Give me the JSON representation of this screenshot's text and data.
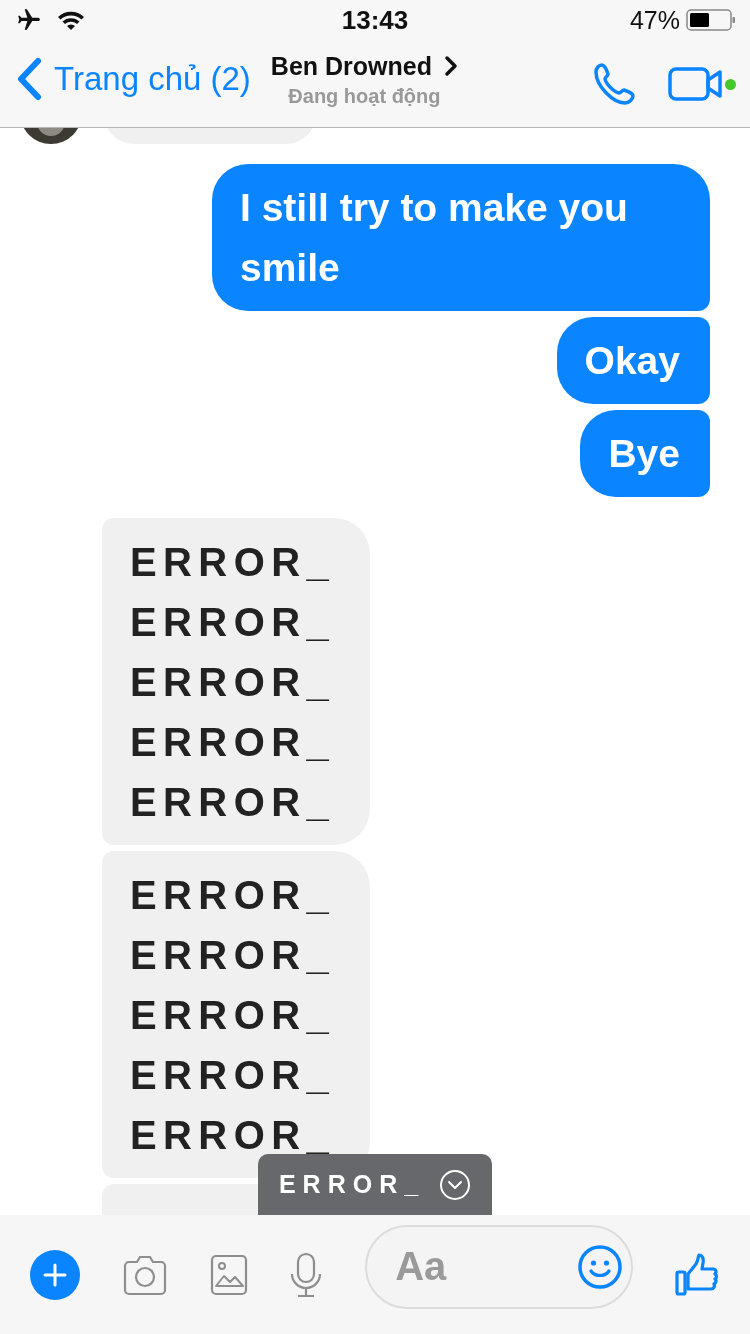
{
  "status_bar": {
    "time": "13:43",
    "battery": "47%"
  },
  "header": {
    "back": "Trang chủ (2)",
    "contact": "Ben Drowned",
    "status": "Đang hoạt động",
    "online": true
  },
  "messages": [
    {
      "kind": "clipped"
    },
    {
      "kind": "outgoing",
      "text": "I still try to make you smile"
    },
    {
      "kind": "outgoing",
      "text": "Okay"
    },
    {
      "kind": "outgoing",
      "text": "Bye"
    },
    {
      "kind": "incoming",
      "lines": [
        "ERROR_",
        "ERROR_",
        "ERROR_",
        "ERROR_",
        "ERROR_"
      ]
    },
    {
      "kind": "incoming",
      "lines": [
        "ERROR_",
        "ERROR_",
        "ERROR_",
        "ERROR_",
        "ERROR_"
      ]
    },
    {
      "kind": "clipped-bottom"
    }
  ],
  "new_message_pill": {
    "label": "ERROR_"
  },
  "composer": {
    "placeholder": "Aa"
  }
}
